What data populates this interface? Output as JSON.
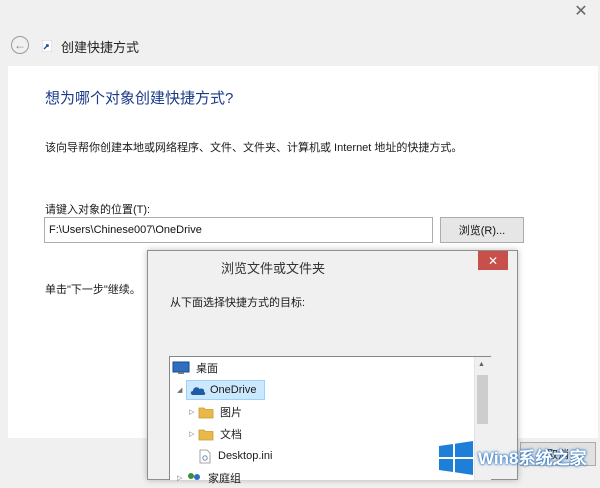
{
  "wizard": {
    "title": "创建快捷方式",
    "question": "想为哪个对象创建快捷方式?",
    "description": "该向导帮你创建本地或网络程序、文件、文件夹、计算机或 Internet 地址的快捷方式。",
    "location_label": "请键入对象的位置(T):",
    "location_value": "F:\\Users\\Chinese007\\OneDrive",
    "browse_label": "浏览(R)...",
    "hint": "单击\"下一步\"继续。",
    "cancel_label": "取消"
  },
  "dialog": {
    "title": "浏览文件或文件夹",
    "prompt": "从下面选择快捷方式的目标:",
    "tree": [
      {
        "label": "桌面",
        "icon": "desktop-icon",
        "expander": "",
        "selected": false
      },
      {
        "label": "OneDrive",
        "icon": "onedrive-cloud-icon",
        "expander": "expanded",
        "selected": true
      },
      {
        "label": "图片",
        "icon": "folder-icon",
        "expander": "collapsed",
        "selected": false
      },
      {
        "label": "文档",
        "icon": "folder-icon",
        "expander": "collapsed",
        "selected": false
      },
      {
        "label": "Desktop.ini",
        "icon": "file-icon",
        "expander": "",
        "selected": false
      },
      {
        "label": "家庭组",
        "icon": "homegroup-icon",
        "expander": "collapsed",
        "selected": false
      }
    ]
  },
  "watermark": {
    "text": "Win8系统之家",
    "logo": "windows-logo-icon"
  },
  "colors": {
    "heading_blue": "#1a3a8a",
    "selection_bg": "#cce8ff",
    "close_red": "#c7504a",
    "folder_yellow": "#e8b94a",
    "onedrive_blue": "#1f5ba6"
  }
}
